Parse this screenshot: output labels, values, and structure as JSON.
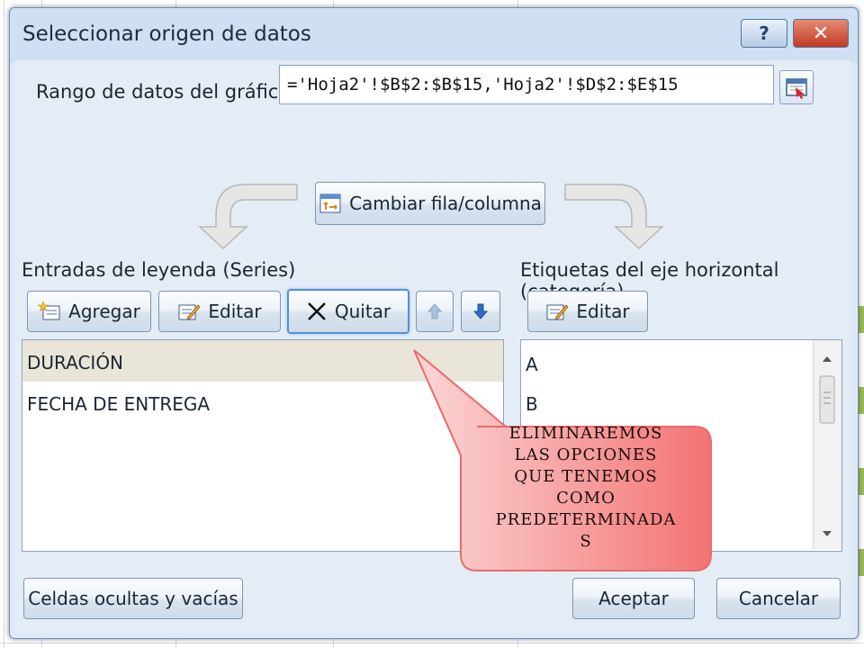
{
  "dialog": {
    "title": "Seleccionar origen de datos",
    "help_label": "?",
    "close_label": "✕"
  },
  "range": {
    "label": "Rango de datos del gráfico:",
    "value": "='Hoja2'!$B$2:$B$15,'Hoja2'!$D$2:$E$15"
  },
  "switch_button": {
    "label": "Cambiar fila/columna"
  },
  "legend": {
    "heading": "Entradas de leyenda (Series)",
    "add_label": "Agregar",
    "edit_label": "Editar",
    "remove_label": "Quitar",
    "items": [
      "DURACIÓN",
      "FECHA DE ENTREGA"
    ]
  },
  "axis": {
    "heading": "Etiquetas del eje horizontal (categoría)",
    "edit_label": "Editar",
    "items": [
      "A",
      "B"
    ]
  },
  "footer": {
    "hidden_cells_label": "Celdas ocultas y vacías",
    "ok_label": "Aceptar",
    "cancel_label": "Cancelar"
  },
  "callout": {
    "lines": [
      "ELIMINAREMOS",
      "LAS OPCIONES",
      "QUE TENEMOS",
      "COMO",
      "PREDETERMINADA",
      "S"
    ],
    "fill_color": "#f47c7c",
    "border_color": "#e96b6b"
  }
}
